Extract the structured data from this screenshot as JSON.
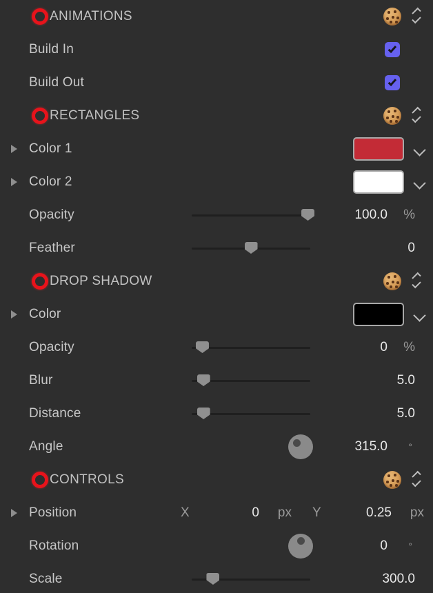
{
  "theme": {
    "background": "#2e2e2e",
    "label_color": "#c8c8c8",
    "value_color": "#e8e8e8",
    "unit_color": "#9a9a9a",
    "accent_checkbox": "#6661ef",
    "record_ring": "#e8131b",
    "slider_track": "#1f1f1f",
    "slider_knob": "#909090",
    "dial_face": "#8a8a8a"
  },
  "rows": [
    {
      "id": "animations",
      "kind": "section",
      "label": "ANIMATIONS",
      "icon": "record-ring-icon",
      "right_icon": "cookie-icon",
      "stepper": true
    },
    {
      "id": "build-in",
      "kind": "checkbox",
      "label": "Build In",
      "checked": true
    },
    {
      "id": "build-out",
      "kind": "checkbox",
      "label": "Build Out",
      "checked": true
    },
    {
      "id": "rectangles",
      "kind": "section",
      "label": "RECTANGLES",
      "icon": "record-ring-icon",
      "right_icon": "cookie-icon",
      "stepper": true
    },
    {
      "id": "color-1",
      "kind": "color",
      "label": "Color 1",
      "disclosure": true,
      "color": "#c32b36"
    },
    {
      "id": "color-2",
      "kind": "color",
      "label": "Color 2",
      "disclosure": true,
      "color": "#ffffff"
    },
    {
      "id": "rect-opacity",
      "kind": "slider",
      "label": "Opacity",
      "value": "100.0",
      "unit": "%",
      "fill": 0.98
    },
    {
      "id": "rect-feather",
      "kind": "slider",
      "label": "Feather",
      "value": "0",
      "unit": "",
      "fill": 0.5
    },
    {
      "id": "drop-shadow",
      "kind": "section",
      "label": "DROP SHADOW",
      "icon": "record-ring-icon",
      "right_icon": "cookie-icon",
      "stepper": true
    },
    {
      "id": "shadow-color",
      "kind": "color",
      "label": "Color",
      "disclosure": true,
      "color": "#000000"
    },
    {
      "id": "shadow-opacity",
      "kind": "slider",
      "label": "Opacity",
      "value": "0",
      "unit": "%",
      "fill": 0.09
    },
    {
      "id": "shadow-blur",
      "kind": "slider",
      "label": "Blur",
      "value": "5.0",
      "unit": "",
      "fill": 0.1
    },
    {
      "id": "shadow-distance",
      "kind": "slider",
      "label": "Distance",
      "value": "5.0",
      "unit": "",
      "fill": 0.1
    },
    {
      "id": "shadow-angle",
      "kind": "dial",
      "label": "Angle",
      "value": "315.0",
      "unit": "°",
      "angle": 315
    },
    {
      "id": "controls",
      "kind": "section",
      "label": "CONTROLS",
      "icon": "record-ring-icon",
      "right_icon": "cookie-icon",
      "stepper": true
    },
    {
      "id": "position",
      "kind": "xy",
      "label": "Position",
      "disclosure": true,
      "x_axis": "X",
      "x_value": "0",
      "x_unit": "px",
      "y_axis": "Y",
      "y_value": "0.25",
      "y_unit": "px"
    },
    {
      "id": "rotation",
      "kind": "dial",
      "label": "Rotation",
      "value": "0",
      "unit": "°",
      "angle": 0
    },
    {
      "id": "scale",
      "kind": "slider",
      "label": "Scale",
      "value": "300.0",
      "unit": "",
      "fill": 0.18
    }
  ]
}
